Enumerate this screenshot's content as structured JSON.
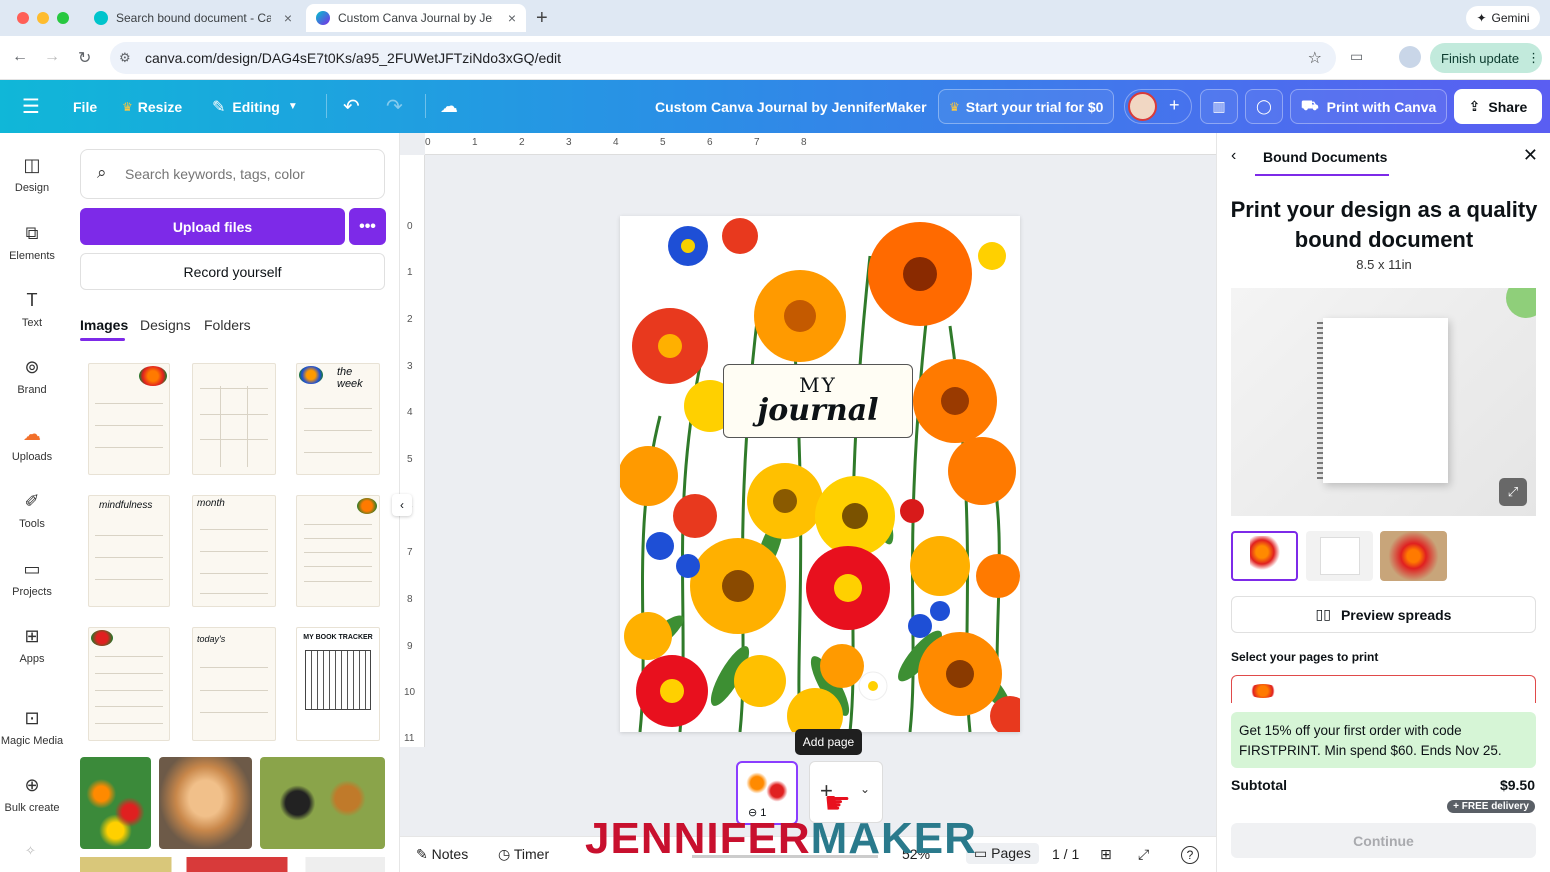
{
  "browser": {
    "tabs": [
      {
        "title": "Search bound document - Ca"
      },
      {
        "title": "Custom Canva Journal by Jen"
      }
    ],
    "url": "canva.com/design/DAG4sE7t0Ks/a95_2FUWetJFTziNdo3xGQ/edit",
    "gemini_label": "Gemini",
    "finish_update_label": "Finish update"
  },
  "toolbar": {
    "file": "File",
    "resize": "Resize",
    "editing": "Editing",
    "doc_title": "Custom Canva Journal by JenniferMaker",
    "trial": "Start your trial for $0",
    "print": "Print with Canva",
    "share": "Share"
  },
  "rail": [
    {
      "label": "Design",
      "icon": "design-icon"
    },
    {
      "label": "Elements",
      "icon": "elements-icon"
    },
    {
      "label": "Text",
      "icon": "text-icon"
    },
    {
      "label": "Brand",
      "icon": "brand-icon"
    },
    {
      "label": "Uploads",
      "icon": "uploads-icon"
    },
    {
      "label": "Tools",
      "icon": "tools-icon"
    },
    {
      "label": "Projects",
      "icon": "projects-icon"
    },
    {
      "label": "Apps",
      "icon": "apps-icon"
    },
    {
      "label": "Magic Media",
      "icon": "magic-media-icon"
    },
    {
      "label": "Bulk create",
      "icon": "bulk-create-icon"
    }
  ],
  "panel": {
    "search_placeholder": "Search keywords, tags, color",
    "upload": "Upload files",
    "record": "Record yourself",
    "tabs": [
      "Images",
      "Designs",
      "Folders"
    ],
    "thumb_labels": {
      "week": "the week",
      "mindfulness": "mindfulness",
      "month": "month",
      "today": "today's",
      "book": "MY BOOK TRACKER"
    }
  },
  "ruler": {
    "top": [
      "0",
      "1",
      "2",
      "3",
      "4",
      "5",
      "6",
      "7",
      "8"
    ],
    "left": [
      "0",
      "1",
      "2",
      "3",
      "4",
      "5",
      "6",
      "7",
      "8",
      "9",
      "10",
      "11"
    ]
  },
  "canvas": {
    "title_line1": "MY",
    "title_line2": "journal",
    "tooltip": "Add page",
    "page_number": "1"
  },
  "bottombar": {
    "notes": "Notes",
    "timer": "Timer",
    "zoom": "52%",
    "pages": "Pages",
    "page_count": "1 / 1"
  },
  "right_panel": {
    "header": "Bound Documents",
    "title": "Print your design as a quality bound document",
    "size": "8.5 x 11in",
    "preview": "Preview spreads",
    "select_label": "Select your pages to print",
    "promo": "Get 15% off your first order with code FIRSTPRINT. Min spend $60. Ends Nov 25.",
    "subtotal_label": "Subtotal",
    "subtotal": "$9.50",
    "delivery": "+ FREE delivery",
    "continue": "Continue"
  },
  "watermark": {
    "part1": "JENNIFER",
    "part2": "MAKER"
  },
  "colors": {
    "accent": "#7d2ae8",
    "promo": "#d6f5d6",
    "watermark_red": "#c8102e",
    "watermark_teal": "#2a7a8c"
  }
}
